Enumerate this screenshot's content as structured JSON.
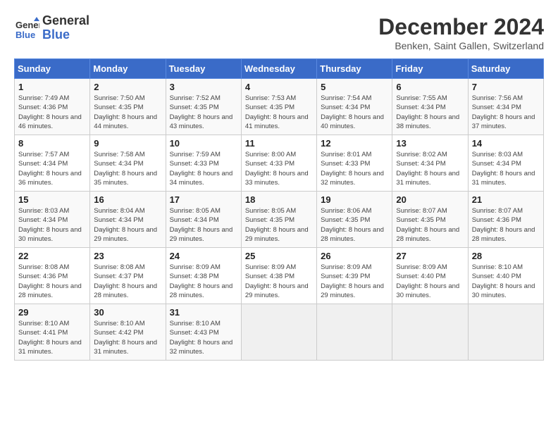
{
  "header": {
    "logo_line1": "General",
    "logo_line2": "Blue",
    "month": "December 2024",
    "location": "Benken, Saint Gallen, Switzerland"
  },
  "days_of_week": [
    "Sunday",
    "Monday",
    "Tuesday",
    "Wednesday",
    "Thursday",
    "Friday",
    "Saturday"
  ],
  "weeks": [
    [
      {
        "day": "1",
        "sunrise": "7:49 AM",
        "sunset": "4:36 PM",
        "daylight": "8 hours and 46 minutes."
      },
      {
        "day": "2",
        "sunrise": "7:50 AM",
        "sunset": "4:35 PM",
        "daylight": "8 hours and 44 minutes."
      },
      {
        "day": "3",
        "sunrise": "7:52 AM",
        "sunset": "4:35 PM",
        "daylight": "8 hours and 43 minutes."
      },
      {
        "day": "4",
        "sunrise": "7:53 AM",
        "sunset": "4:35 PM",
        "daylight": "8 hours and 41 minutes."
      },
      {
        "day": "5",
        "sunrise": "7:54 AM",
        "sunset": "4:34 PM",
        "daylight": "8 hours and 40 minutes."
      },
      {
        "day": "6",
        "sunrise": "7:55 AM",
        "sunset": "4:34 PM",
        "daylight": "8 hours and 38 minutes."
      },
      {
        "day": "7",
        "sunrise": "7:56 AM",
        "sunset": "4:34 PM",
        "daylight": "8 hours and 37 minutes."
      }
    ],
    [
      {
        "day": "8",
        "sunrise": "7:57 AM",
        "sunset": "4:34 PM",
        "daylight": "8 hours and 36 minutes."
      },
      {
        "day": "9",
        "sunrise": "7:58 AM",
        "sunset": "4:34 PM",
        "daylight": "8 hours and 35 minutes."
      },
      {
        "day": "10",
        "sunrise": "7:59 AM",
        "sunset": "4:33 PM",
        "daylight": "8 hours and 34 minutes."
      },
      {
        "day": "11",
        "sunrise": "8:00 AM",
        "sunset": "4:33 PM",
        "daylight": "8 hours and 33 minutes."
      },
      {
        "day": "12",
        "sunrise": "8:01 AM",
        "sunset": "4:33 PM",
        "daylight": "8 hours and 32 minutes."
      },
      {
        "day": "13",
        "sunrise": "8:02 AM",
        "sunset": "4:34 PM",
        "daylight": "8 hours and 31 minutes."
      },
      {
        "day": "14",
        "sunrise": "8:03 AM",
        "sunset": "4:34 PM",
        "daylight": "8 hours and 31 minutes."
      }
    ],
    [
      {
        "day": "15",
        "sunrise": "8:03 AM",
        "sunset": "4:34 PM",
        "daylight": "8 hours and 30 minutes."
      },
      {
        "day": "16",
        "sunrise": "8:04 AM",
        "sunset": "4:34 PM",
        "daylight": "8 hours and 29 minutes."
      },
      {
        "day": "17",
        "sunrise": "8:05 AM",
        "sunset": "4:34 PM",
        "daylight": "8 hours and 29 minutes."
      },
      {
        "day": "18",
        "sunrise": "8:05 AM",
        "sunset": "4:35 PM",
        "daylight": "8 hours and 29 minutes."
      },
      {
        "day": "19",
        "sunrise": "8:06 AM",
        "sunset": "4:35 PM",
        "daylight": "8 hours and 28 minutes."
      },
      {
        "day": "20",
        "sunrise": "8:07 AM",
        "sunset": "4:35 PM",
        "daylight": "8 hours and 28 minutes."
      },
      {
        "day": "21",
        "sunrise": "8:07 AM",
        "sunset": "4:36 PM",
        "daylight": "8 hours and 28 minutes."
      }
    ],
    [
      {
        "day": "22",
        "sunrise": "8:08 AM",
        "sunset": "4:36 PM",
        "daylight": "8 hours and 28 minutes."
      },
      {
        "day": "23",
        "sunrise": "8:08 AM",
        "sunset": "4:37 PM",
        "daylight": "8 hours and 28 minutes."
      },
      {
        "day": "24",
        "sunrise": "8:09 AM",
        "sunset": "4:38 PM",
        "daylight": "8 hours and 28 minutes."
      },
      {
        "day": "25",
        "sunrise": "8:09 AM",
        "sunset": "4:38 PM",
        "daylight": "8 hours and 29 minutes."
      },
      {
        "day": "26",
        "sunrise": "8:09 AM",
        "sunset": "4:39 PM",
        "daylight": "8 hours and 29 minutes."
      },
      {
        "day": "27",
        "sunrise": "8:09 AM",
        "sunset": "4:40 PM",
        "daylight": "8 hours and 30 minutes."
      },
      {
        "day": "28",
        "sunrise": "8:10 AM",
        "sunset": "4:40 PM",
        "daylight": "8 hours and 30 minutes."
      }
    ],
    [
      {
        "day": "29",
        "sunrise": "8:10 AM",
        "sunset": "4:41 PM",
        "daylight": "8 hours and 31 minutes."
      },
      {
        "day": "30",
        "sunrise": "8:10 AM",
        "sunset": "4:42 PM",
        "daylight": "8 hours and 31 minutes."
      },
      {
        "day": "31",
        "sunrise": "8:10 AM",
        "sunset": "4:43 PM",
        "daylight": "8 hours and 32 minutes."
      },
      null,
      null,
      null,
      null
    ]
  ]
}
